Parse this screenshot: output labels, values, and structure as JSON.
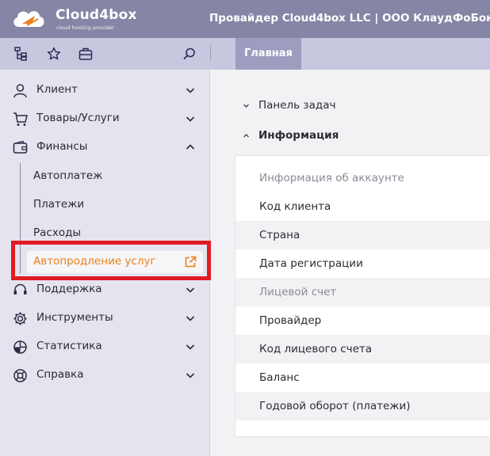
{
  "header": {
    "logo_text": "Cloud4box",
    "logo_subtitle": "cloud hosting provider",
    "provider": "Провайдер Cloud4box LLC | ООО КлаудФоБокс",
    "provider_chevron": "⌄"
  },
  "toolbar": {
    "icons": [
      "sitemap-icon",
      "star-icon",
      "briefcase-icon",
      "search-icon"
    ],
    "tab_main": "Главная"
  },
  "sidebar": {
    "items": [
      {
        "label": "Клиент",
        "icon": "user-icon",
        "expanded": false
      },
      {
        "label": "Товары/Услуги",
        "icon": "cart-icon",
        "expanded": false
      },
      {
        "label": "Финансы",
        "icon": "wallet-icon",
        "expanded": true
      },
      {
        "label": "Поддержка",
        "icon": "headset-icon",
        "expanded": false
      },
      {
        "label": "Инструменты",
        "icon": "gear-icon",
        "expanded": false
      },
      {
        "label": "Статистика",
        "icon": "pie-chart-icon",
        "expanded": false
      },
      {
        "label": "Справка",
        "icon": "lifebuoy-icon",
        "expanded": false
      }
    ],
    "finance_subitems": [
      "Автоплатеж",
      "Платежи",
      "Расходы"
    ],
    "active_subitem": "Автопродление услуг",
    "active_subitem_icon": "external-link-icon"
  },
  "main": {
    "sections": [
      {
        "label": "Панель задач",
        "expanded": false
      },
      {
        "label": "Информация",
        "expanded": true
      }
    ],
    "info_rows": [
      {
        "label": "Информация об аккаунте",
        "muted": true
      },
      {
        "label": "Код клиента",
        "muted": false
      },
      {
        "label": "Страна",
        "muted": false
      },
      {
        "label": "Дата регистрации",
        "muted": false
      },
      {
        "label": "Лицевой счет",
        "muted": true
      },
      {
        "label": "Провайдер",
        "muted": false
      },
      {
        "label": "Код лицевого счета",
        "muted": false
      },
      {
        "label": "Баланс",
        "muted": false
      },
      {
        "label": "Годовой оборот (платежи)",
        "muted": false
      }
    ]
  },
  "colors": {
    "header_bg": "#8585a6",
    "toolbar_bg": "#c8c7e0",
    "sidebar_bg": "#e4e3ee",
    "accent_orange": "#e8801c",
    "highlight_red": "#e01b24"
  }
}
